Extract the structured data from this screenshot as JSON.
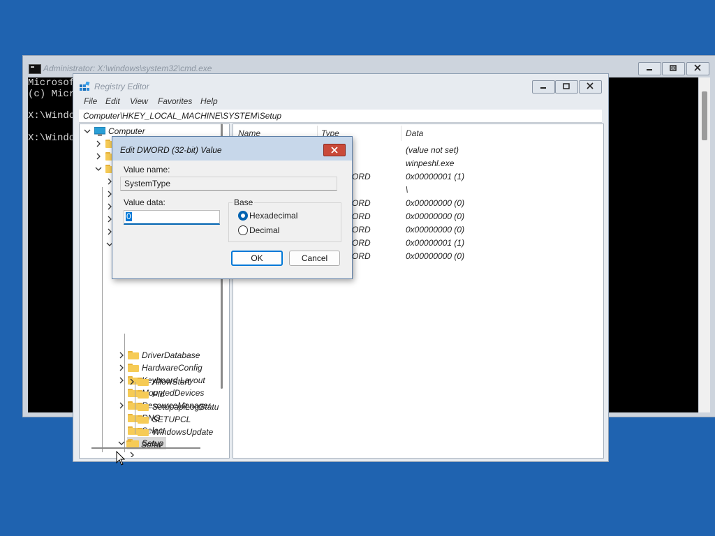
{
  "cmd": {
    "title": "Administrator: X:\\windows\\system32\\cmd.exe",
    "lines": [
      "Microsof",
      "(c) Micr",
      "",
      "X:\\Windo",
      "",
      "X:\\Windo"
    ]
  },
  "regedit": {
    "title": "Registry Editor",
    "menu": [
      "File",
      "Edit",
      "View",
      "Favorites",
      "Help"
    ],
    "address": "Computer\\HKEY_LOCAL_MACHINE\\SYSTEM\\Setup",
    "tree": {
      "root": "Computer",
      "items": [
        "DriverDatabase",
        "HardwareConfig",
        "Keyboard Layout",
        "MountedDevices",
        "ResourceManager",
        "RNG",
        "Select",
        "Setup"
      ],
      "setup_children": [
        "AllowStart",
        "Pid",
        "SetupapiLogStatu",
        "SETUPCL",
        "WindowsUpdate"
      ],
      "partial_below": "Softw"
    },
    "columns": {
      "name": "Name",
      "type": "Type",
      "data": "Data"
    },
    "rows": [
      {
        "type": "",
        "data": "(value not set)"
      },
      {
        "type": "",
        "data": "winpeshl.exe"
      },
      {
        "type": "ORD",
        "data": "0x00000001 (1)"
      },
      {
        "type": "",
        "data": "\\"
      },
      {
        "type": "ORD",
        "data": "0x00000000 (0)"
      },
      {
        "type": "ORD",
        "data": "0x00000000 (0)"
      },
      {
        "type": "ORD",
        "data": "0x00000000 (0)"
      },
      {
        "type": "ORD",
        "data": "0x00000001 (1)"
      },
      {
        "type": "ORD",
        "data": "0x00000000 (0)"
      }
    ]
  },
  "dialog": {
    "title": "Edit DWORD (32-bit) Value",
    "value_name_label": "Value name:",
    "value_name": "SystemType",
    "value_data_label": "Value data:",
    "value_data": "0",
    "base_label": "Base",
    "hex_label": "Hexadecimal",
    "dec_label": "Decimal",
    "base_selected": "Hexadecimal",
    "ok_label": "OK",
    "cancel_label": "Cancel"
  },
  "colors": {
    "desktop": "#1f63b0",
    "accent": "#0078d7",
    "close": "#c94a3a",
    "folder": "#f6cb56"
  }
}
